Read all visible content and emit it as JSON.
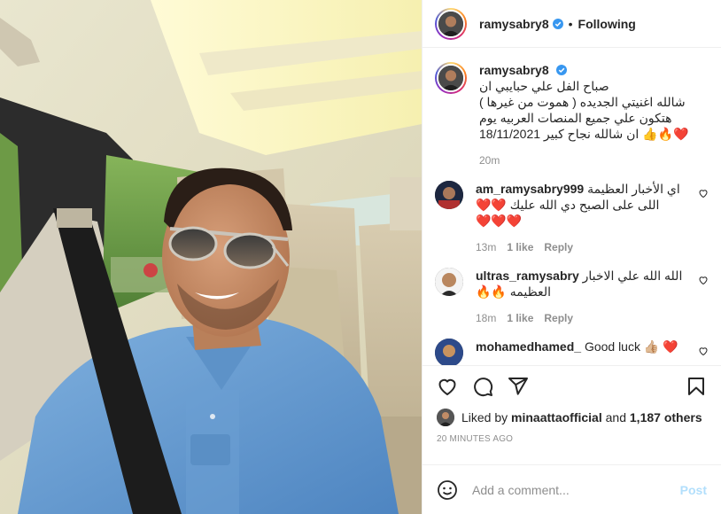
{
  "post": {
    "username": "ramysabry8",
    "follow_status": "Following",
    "separator": "•"
  },
  "caption": {
    "author": "ramysabry8",
    "line1": "صباح الفل علي حبايبي ان",
    "line2": "شالله اغنيتي الجديده ( هموت من غيرها )",
    "line3": "هتكون علي جميع المنصات العربيه يوم",
    "line4": "18/11/2021 ان شالله نجاح كبير",
    "emoji": "👍🔥❤️",
    "time": "20m"
  },
  "comments": [
    {
      "author": "am_ramysabry999",
      "line1": "اي الأخبار العظيمة",
      "line2": "اللى على الصبح دي الله عليك ❤️❤️",
      "line3": "❤️❤️❤️",
      "time": "13m",
      "likes": "1 like",
      "reply": "Reply"
    },
    {
      "author": "ultras_ramysabry",
      "line1": "الله الله علي الاخبار",
      "line2": "العظيمه 🔥🔥",
      "time": "18m",
      "likes": "1 like",
      "reply": "Reply"
    },
    {
      "author": "mohamedhamed_",
      "text": "Good luck 👍🏼 ❤️"
    }
  ],
  "likes": {
    "prefix": "Liked by",
    "user": "minaattaofficial",
    "joiner": "and",
    "count": "1,187 others"
  },
  "timestamp": "20 MINUTES AGO",
  "add_comment": {
    "placeholder": "Add a comment...",
    "post_label": "Post"
  },
  "colors": {
    "verified": "#3897f0",
    "border": "#efefef",
    "muted": "#8e8e8e",
    "post_disabled": "#b2dffc"
  },
  "icons": [
    "heart-icon",
    "comment-icon",
    "share-icon",
    "bookmark-icon",
    "emoji-icon",
    "verified-icon"
  ]
}
